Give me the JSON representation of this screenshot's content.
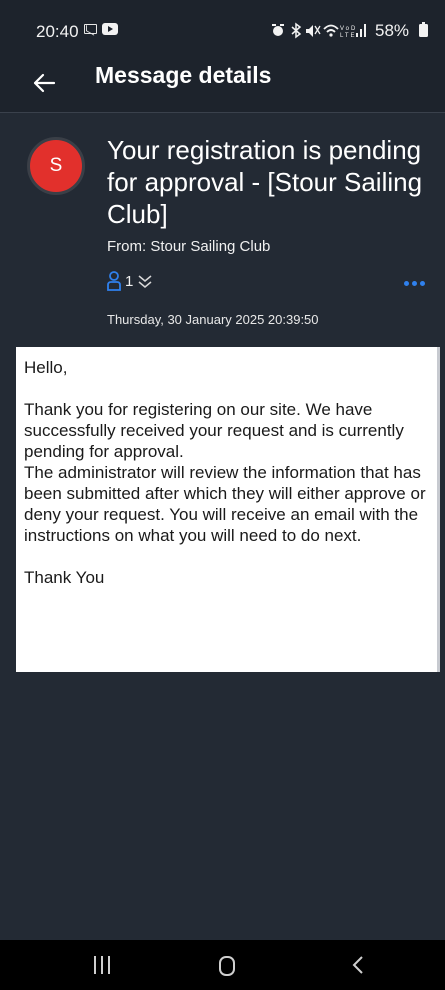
{
  "status_bar": {
    "time": "20:40",
    "icons_text": "⏰ ✱ ⧳ ≋ LTE .││",
    "battery": "58%"
  },
  "app_bar": {
    "title": "Message details",
    "back_icon": "arrow-left-icon"
  },
  "message": {
    "avatar_letter": "S",
    "avatar_color": "#e2302c",
    "subject": "Your registration is pending for approval - [Stour Sailing Club]",
    "from": "From: Stour Sailing Club",
    "recipient_count": "1",
    "date": "Thursday, 30 January 2025 20:39:50",
    "accent_color": "#2f80ed",
    "body": {
      "greeting": "Hello,",
      "paragraph1": "Thank you for registering on our site. We have successfully received your request and is currently pending for approval.",
      "paragraph2": "The administrator will review the information that has been submitted after which they will either approve or deny your request. You will receive an email with the instructions on what you will need to do next.",
      "signoff": "Thank You"
    }
  },
  "nav_bar": {
    "recents_icon": "recents-icon",
    "home_icon": "home-icon",
    "back_icon": "back-chevron-icon"
  }
}
